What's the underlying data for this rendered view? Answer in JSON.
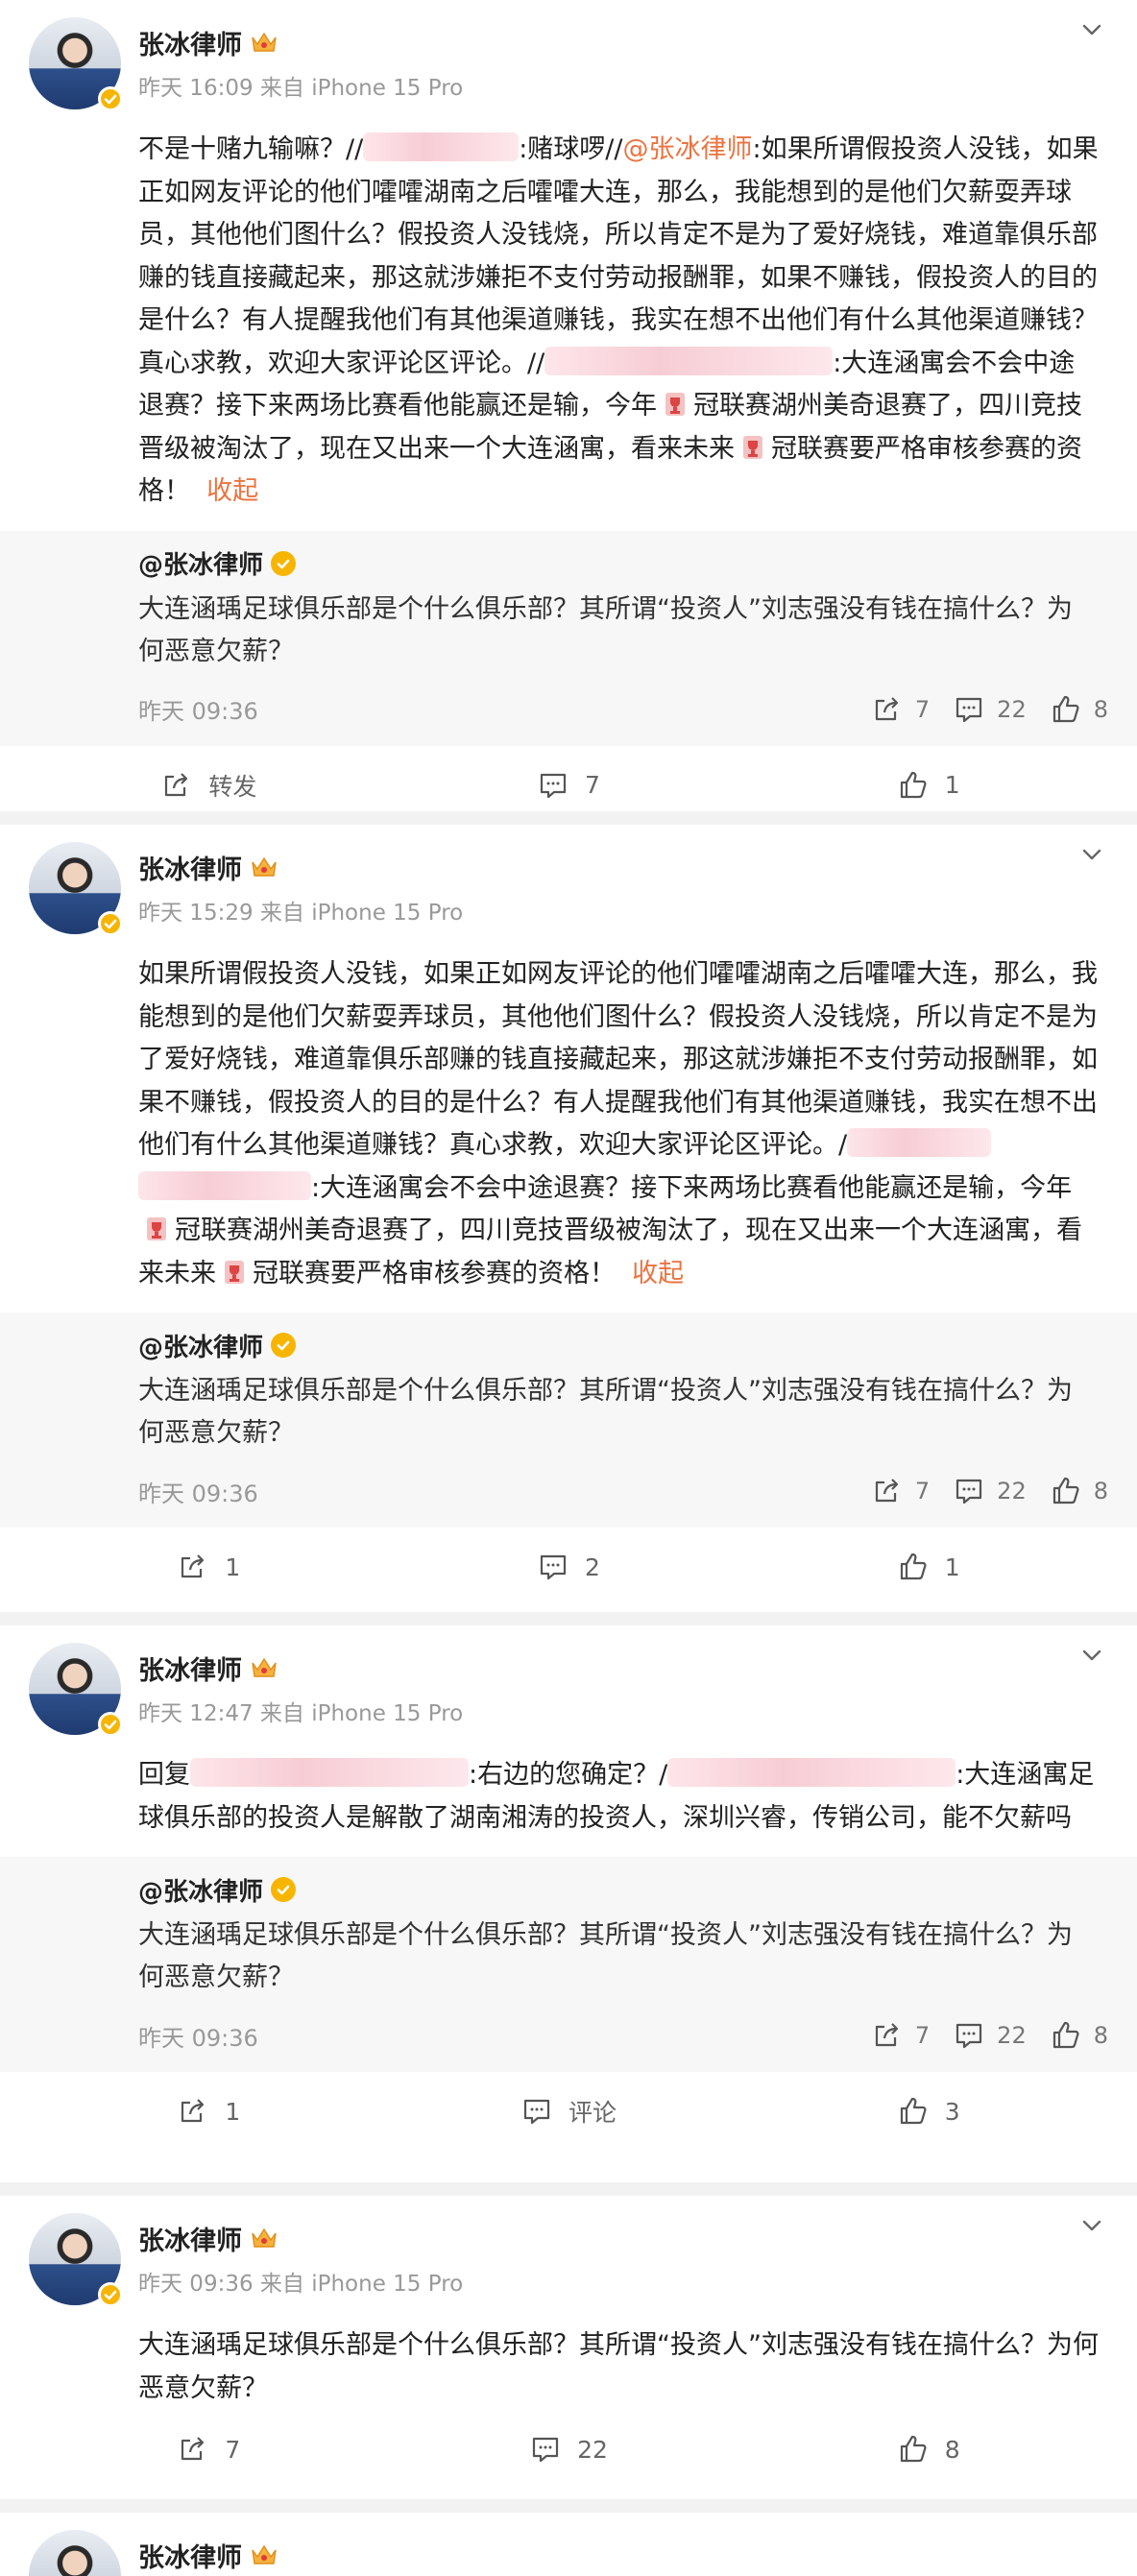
{
  "posts": [
    {
      "author": "张冰律师",
      "sub": "昨天 16:09  来自 iPhone 15 Pro",
      "text": {
        "p1": "不是十赌九输嘛？//",
        "p2": ":赌球啰//",
        "mention": "@张冰律师",
        "p3": ":如果所谓假投资人没钱，如果正如网友评论的他们嚯嚯湖南之后嚯嚯大连，那么，我能想到的是他们欠薪耍弄球员，其他他们图什么？假投资人没钱烧，所以肯定不是为了爱好烧钱，难道靠俱乐部赚的钱直接藏起来，那这就涉嫌拒不支付劳动报酬罪，如果不赚钱，假投资人的目的是什么？有人提醒我他们有其他渠道赚钱，我实在想不出他们有什么其他渠道赚钱？真心求教，欢迎大家评论区评论。//",
        "p4": ":大连涵寓会不会中途退赛？接下来两场比赛看他能赢还是输，今年",
        "p5": "冠联赛湖州美奇退赛了，四川竞技晋级被淘汰了，现在又出来一个大连涵寓，看来未来",
        "p6": "冠联赛要严格审核参赛的资格！",
        "collapse": "收起"
      },
      "quote": {
        "name": "@张冰律师",
        "text": "大连涵瑀足球俱乐部是个什么俱乐部？其所谓“投资人”刘志强没有钱在搞什么？为何恶意欠薪？",
        "time": "昨天 09:36",
        "repost": "7",
        "comment": "22",
        "like": "8"
      },
      "actions": {
        "repost": "转发",
        "comment": "7",
        "like": "1"
      }
    },
    {
      "author": "张冰律师",
      "sub": "昨天 15:29  来自 iPhone 15 Pro",
      "text": {
        "p1": "如果所谓假投资人没钱，如果正如网友评论的他们嚯嚯湖南之后嚯嚯大连，那么，我能想到的是他们欠薪耍弄球员，其他他们图什么？假投资人没钱烧，所以肯定不是为了爱好烧钱，难道靠俱乐部赚的钱直接藏起来，那这就涉嫌拒不支付劳动报酬罪，如果不赚钱，假投资人的目的是什么？有人提醒我他们有其他渠道赚钱，我实在想不出他们有什么其他渠道赚钱？真心求教，欢迎大家评论区评论。/",
        "p2": ":大连涵寓会不会中途退赛？接下来两场比赛看他能赢还是输，今年",
        "p3": "冠联赛湖州美奇退赛了，四川竞技晋级被淘汰了，现在又出来一个大连涵寓，看来未来",
        "p4": "冠联赛要严格审核参赛的资格！",
        "collapse": "收起"
      },
      "quote": {
        "name": "@张冰律师",
        "text": "大连涵瑀足球俱乐部是个什么俱乐部？其所谓“投资人”刘志强没有钱在搞什么？为何恶意欠薪？",
        "time": "昨天 09:36",
        "repost": "7",
        "comment": "22",
        "like": "8"
      },
      "actions": {
        "repost": "1",
        "comment": "2",
        "like": "1"
      }
    },
    {
      "author": "张冰律师",
      "sub": "昨天 12:47  来自 iPhone 15 Pro",
      "text": {
        "p1": "回复",
        "p2": ":右边的您确定？/",
        "p3": ":大连涵寓足球俱乐部的投资人是解散了湖南湘涛的投资人，深圳兴睿，传销公司，能不欠薪吗"
      },
      "quote": {
        "name": "@张冰律师",
        "text": "大连涵瑀足球俱乐部是个什么俱乐部？其所谓“投资人”刘志强没有钱在搞什么？为何恶意欠薪？",
        "time": "昨天 09:36",
        "repost": "7",
        "comment": "22",
        "like": "8"
      },
      "actions": {
        "repost": "1",
        "comment": "评论",
        "like": "3"
      }
    },
    {
      "author": "张冰律师",
      "sub": "昨天 09:36  来自 iPhone 15 Pro",
      "text": {
        "p1": "大连涵瑀足球俱乐部是个什么俱乐部？其所谓“投资人”刘志强没有钱在搞什么？为何恶意欠薪？"
      },
      "actions": {
        "repost": "7",
        "comment": "22",
        "like": "8"
      }
    },
    {
      "author": "张冰律师"
    }
  ],
  "colors": {
    "accent": "#eb7340",
    "verified": "#f7b500",
    "muted": "#999999"
  },
  "icons": [
    "chevron-down-icon",
    "verified-badge-icon",
    "crown-icon",
    "trophy-icon",
    "repost-icon",
    "comment-icon",
    "like-icon"
  ]
}
